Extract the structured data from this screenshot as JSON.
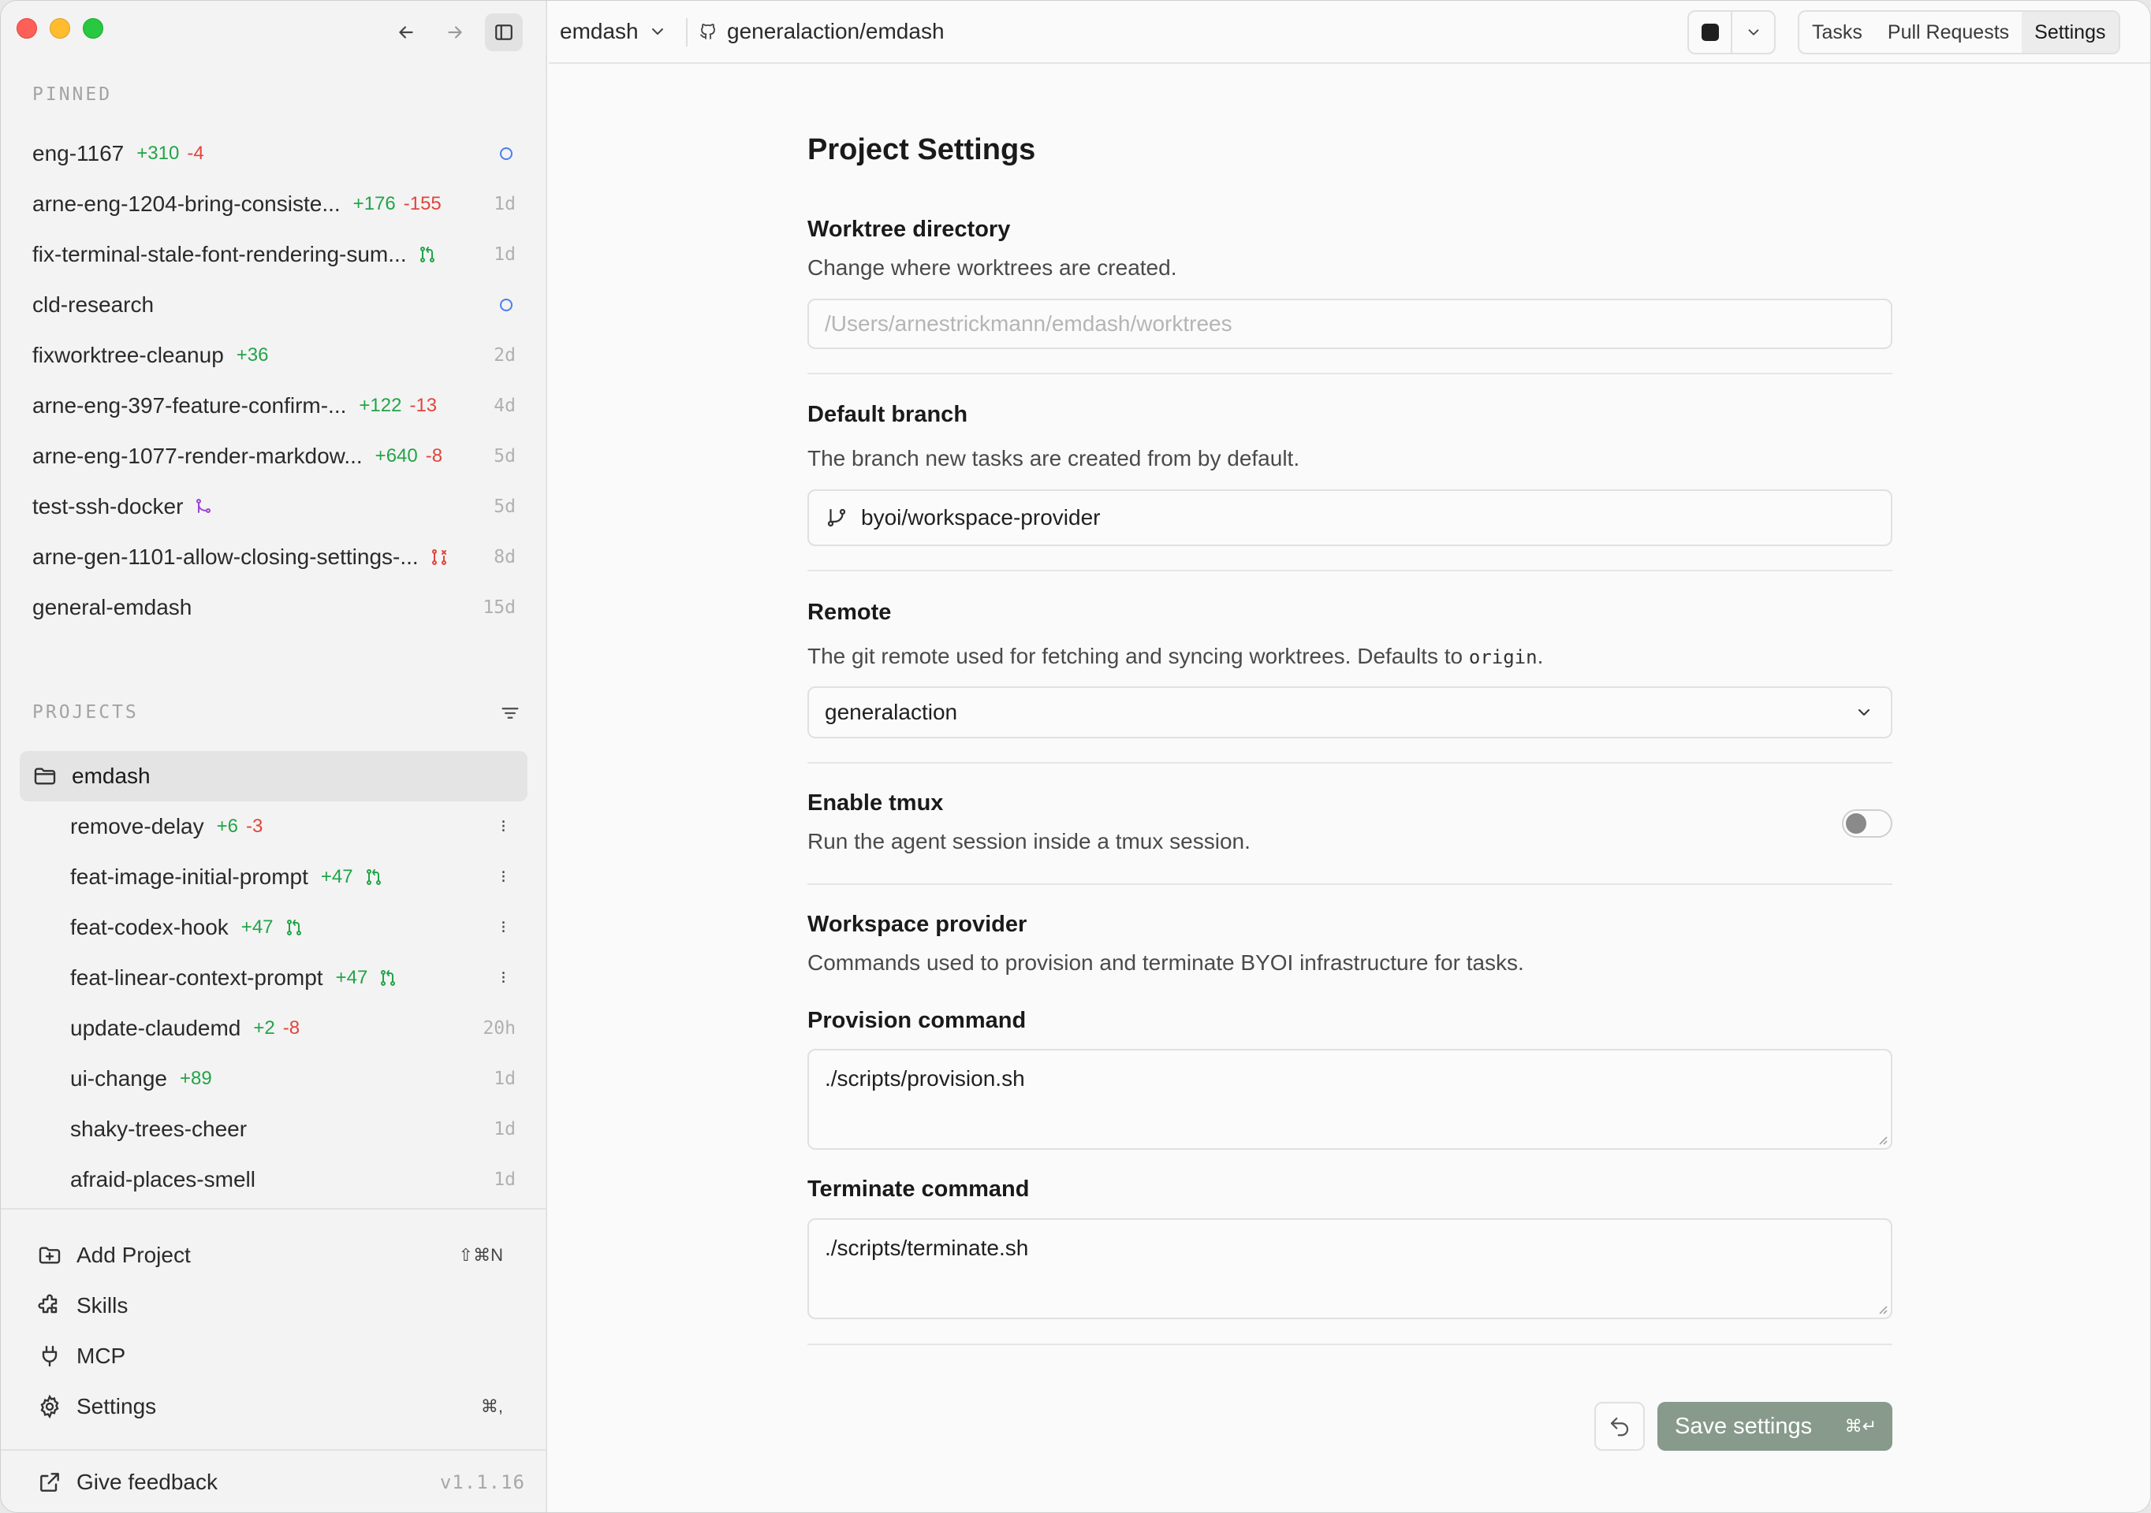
{
  "sidebar": {
    "pinned_label": "PINNED",
    "pinned": [
      {
        "name": "eng-1167",
        "add": "+310",
        "del": "-4",
        "age": "",
        "status": "dot"
      },
      {
        "name": "arne-eng-1204-bring-consiste...",
        "add": "+176",
        "del": "-155",
        "age": "1d",
        "status": ""
      },
      {
        "name": "fix-terminal-stale-font-rendering-sum...",
        "add": "",
        "del": "",
        "age": "1d",
        "status": "pr-green"
      },
      {
        "name": "cld-research",
        "add": "",
        "del": "",
        "age": "",
        "status": "dot"
      },
      {
        "name": "fixworktree-cleanup",
        "add": "+36",
        "del": "",
        "age": "2d",
        "status": ""
      },
      {
        "name": "arne-eng-397-feature-confirm-...",
        "add": "+122",
        "del": "-13",
        "age": "4d",
        "status": ""
      },
      {
        "name": "arne-eng-1077-render-markdow...",
        "add": "+640",
        "del": "-8",
        "age": "5d",
        "status": ""
      },
      {
        "name": "test-ssh-docker",
        "add": "",
        "del": "",
        "age": "5d",
        "status": "merged-purple"
      },
      {
        "name": "arne-gen-1101-allow-closing-settings-...",
        "add": "",
        "del": "",
        "age": "8d",
        "status": "pr-red"
      },
      {
        "name": "general-emdash",
        "add": "",
        "del": "",
        "age": "15d",
        "status": ""
      }
    ],
    "projects_label": "PROJECTS",
    "project": {
      "name": "emdash"
    },
    "project_tasks": [
      {
        "name": "remove-delay",
        "add": "+6",
        "del": "-3",
        "age": "",
        "status": "dots"
      },
      {
        "name": "feat-image-initial-prompt",
        "add": "+47",
        "del": "",
        "age": "",
        "status": "pr-green-dots"
      },
      {
        "name": "feat-codex-hook",
        "add": "+47",
        "del": "",
        "age": "",
        "status": "pr-green-dots"
      },
      {
        "name": "feat-linear-context-prompt",
        "add": "+47",
        "del": "",
        "age": "",
        "status": "pr-green-dots"
      },
      {
        "name": "update-claudemd",
        "add": "+2",
        "del": "-8",
        "age": "20h",
        "status": ""
      },
      {
        "name": "ui-change",
        "add": "+89",
        "del": "",
        "age": "1d",
        "status": ""
      },
      {
        "name": "shaky-trees-cheer",
        "add": "",
        "del": "",
        "age": "1d",
        "status": ""
      },
      {
        "name": "afraid-places-smell",
        "add": "",
        "del": "",
        "age": "1d",
        "status": ""
      }
    ],
    "menu": {
      "add_project": "Add Project",
      "add_project_kbd": "⇧⌘N",
      "skills": "Skills",
      "mcp": "MCP",
      "settings": "Settings",
      "settings_kbd": "⌘,"
    },
    "feedback": "Give feedback",
    "version": "v1.1.16"
  },
  "topbar": {
    "project": "emdash",
    "repo": "generalaction/emdash",
    "tabs": [
      "Tasks",
      "Pull Requests",
      "Settings"
    ],
    "active_tab": "Settings"
  },
  "settings": {
    "title": "Project Settings",
    "worktree": {
      "label": "Worktree directory",
      "desc": "Change where worktrees are created.",
      "placeholder": "/Users/arnestrickmann/emdash/worktrees"
    },
    "branch": {
      "label": "Default branch",
      "desc": "The branch new tasks are created from by default.",
      "value": "byoi/workspace-provider"
    },
    "remote": {
      "label": "Remote",
      "desc_before": "The git remote used for fetching and syncing worktrees. Defaults to",
      "desc_code": "origin",
      "desc_after": ".",
      "value": "generalaction"
    },
    "tmux": {
      "label": "Enable tmux",
      "desc": "Run the agent session inside a tmux session.",
      "enabled": false
    },
    "provider": {
      "label": "Workspace provider",
      "desc": "Commands used to provision and terminate BYOI infrastructure for tasks.",
      "provision_label": "Provision command",
      "provision_value": "./scripts/provision.sh",
      "terminate_label": "Terminate command",
      "terminate_value": "./scripts/terminate.sh"
    },
    "save_label": "Save settings",
    "save_kbd": "⌘↵"
  },
  "colors": {
    "additions": "#22a447",
    "deletions": "#e0453c",
    "save_button": "#879a8c",
    "status_dot": "#4a7ef0"
  }
}
